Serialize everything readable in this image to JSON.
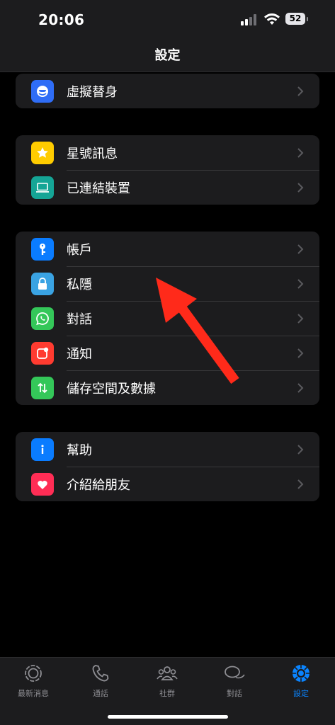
{
  "status": {
    "time": "20:06",
    "battery": "52"
  },
  "header": {
    "title": "設定"
  },
  "groups": [
    {
      "items": [
        {
          "label": "虛擬替身",
          "icon": "avatar-icon",
          "color": "#2f6df6"
        }
      ]
    },
    {
      "items": [
        {
          "label": "星號訊息",
          "icon": "star-icon",
          "color": "#ffcc00"
        },
        {
          "label": "已連結裝置",
          "icon": "laptop-icon",
          "color": "#15a596"
        }
      ]
    },
    {
      "items": [
        {
          "label": "帳戶",
          "icon": "key-icon",
          "color": "#0a7cff"
        },
        {
          "label": "私隱",
          "icon": "lock-icon",
          "color": "#3aa3e3"
        },
        {
          "label": "對話",
          "icon": "whatsapp-icon",
          "color": "#34c759"
        },
        {
          "label": "通知",
          "icon": "notification-icon",
          "color": "#ff3b30"
        },
        {
          "label": "儲存空間及數據",
          "icon": "arrows-icon",
          "color": "#34c759"
        }
      ]
    },
    {
      "items": [
        {
          "label": "幫助",
          "icon": "info-icon",
          "color": "#0a7cff"
        },
        {
          "label": "介紹給朋友",
          "icon": "heart-icon",
          "color": "#ff2d55"
        }
      ]
    }
  ],
  "tabs": [
    {
      "label": "最新消息",
      "icon": "updates-icon"
    },
    {
      "label": "通話",
      "icon": "phone-icon"
    },
    {
      "label": "社群",
      "icon": "community-icon"
    },
    {
      "label": "對話",
      "icon": "chats-icon"
    },
    {
      "label": "設定",
      "icon": "settings-icon",
      "active": true
    }
  ],
  "colors": {
    "accent": "#0a84ff",
    "annotation_arrow": "#ff2a1a"
  }
}
